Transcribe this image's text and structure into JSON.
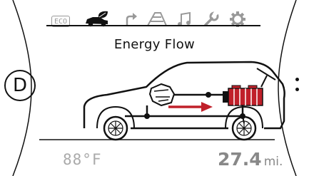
{
  "topbar": {
    "eco_label": "ECO",
    "tabs": [
      {
        "icon": "car-leaf-icon",
        "active": true
      },
      {
        "icon": "turn-arrow-icon",
        "active": false
      },
      {
        "icon": "road-icon",
        "active": false
      },
      {
        "icon": "music-note-icon",
        "active": false
      },
      {
        "icon": "wrench-icon",
        "active": false
      },
      {
        "icon": "gear-icon",
        "active": false
      }
    ]
  },
  "screen": {
    "title": "Energy Flow",
    "gear": "D"
  },
  "footer": {
    "temperature": "88°F",
    "range_value": "27.4",
    "range_unit": "mi."
  },
  "colors": {
    "flow_arrow": "#c0202a",
    "battery": "#c0202a",
    "outline": "#111111",
    "dim_text": "#999999"
  }
}
